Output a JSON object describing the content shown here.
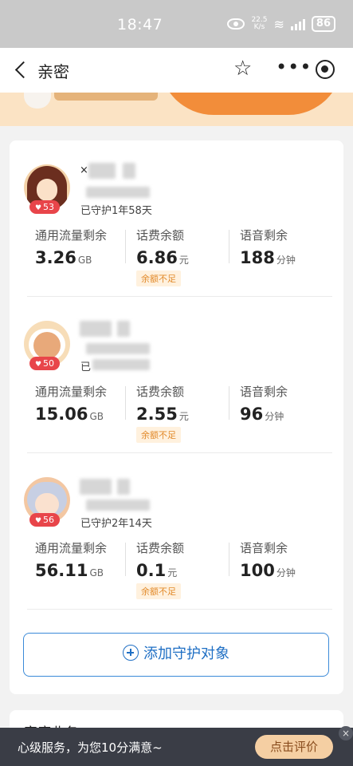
{
  "status_bar": {
    "time": "18:47",
    "net_speed_top": "22.5",
    "net_speed_bottom": "K/s",
    "signal": "5G",
    "battery": "86"
  },
  "nav": {
    "title": "亲密",
    "star_icon": "☆",
    "more_icon": "•••"
  },
  "members": [
    {
      "badge": "53",
      "name_prefix": "×",
      "guard_text": "已守护1年58天",
      "stats": [
        {
          "label": "通用流量剩余",
          "value": "3.26",
          "unit": "GB"
        },
        {
          "label": "话费余额",
          "value": "6.86",
          "unit": "元",
          "warning": "余额不足"
        },
        {
          "label": "语音剩余",
          "value": "188",
          "unit": "分钟"
        }
      ]
    },
    {
      "badge": "50",
      "name_prefix": "",
      "guard_text": "已",
      "stats": [
        {
          "label": "通用流量剩余",
          "value": "15.06",
          "unit": "GB"
        },
        {
          "label": "话费余额",
          "value": "2.55",
          "unit": "元",
          "warning": "余额不足"
        },
        {
          "label": "语音剩余",
          "value": "96",
          "unit": "分钟"
        }
      ]
    },
    {
      "badge": "56",
      "name_prefix": "",
      "guard_text": "已守护2年14天",
      "stats": [
        {
          "label": "通用流量剩余",
          "value": "56.11",
          "unit": "GB"
        },
        {
          "label": "话费余额",
          "value": "0.1",
          "unit": "元",
          "warning": "余额不足"
        },
        {
          "label": "语音剩余",
          "value": "100",
          "unit": "分钟"
        }
      ]
    }
  ],
  "add_button": {
    "label": "添加守护对象"
  },
  "section2": {
    "title": "家庭业务"
  },
  "toast": {
    "message": "心级服务，为您10分满意~",
    "action": "点击评价",
    "close": "×"
  }
}
